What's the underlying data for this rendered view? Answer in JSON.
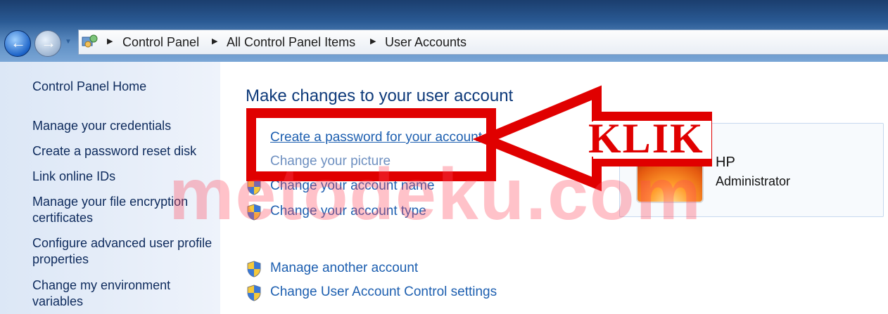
{
  "breadcrumb": {
    "items": [
      "Control Panel",
      "All Control Panel Items",
      "User Accounts"
    ]
  },
  "sidebar": {
    "items": [
      {
        "label": "Control Panel Home"
      },
      {
        "label": "Manage your credentials"
      },
      {
        "label": "Create a password reset disk"
      },
      {
        "label": "Link online IDs"
      },
      {
        "label": "Manage your file encryption certificates"
      },
      {
        "label": "Configure advanced user profile properties"
      },
      {
        "label": "Change my environment variables"
      }
    ]
  },
  "main": {
    "heading": "Make changes to your user account",
    "links": {
      "create_password": "Create a password for your account",
      "change_picture": "Change your picture",
      "change_name": "Change your account name",
      "change_type": "Change your account type",
      "manage_another": "Manage another account",
      "uac_settings": "Change User Account Control settings"
    }
  },
  "user": {
    "name": "HP",
    "role": "Administrator"
  },
  "annotation": {
    "callout_text": "KLIK",
    "watermark": "metodeku.com",
    "color": "#e00000"
  }
}
